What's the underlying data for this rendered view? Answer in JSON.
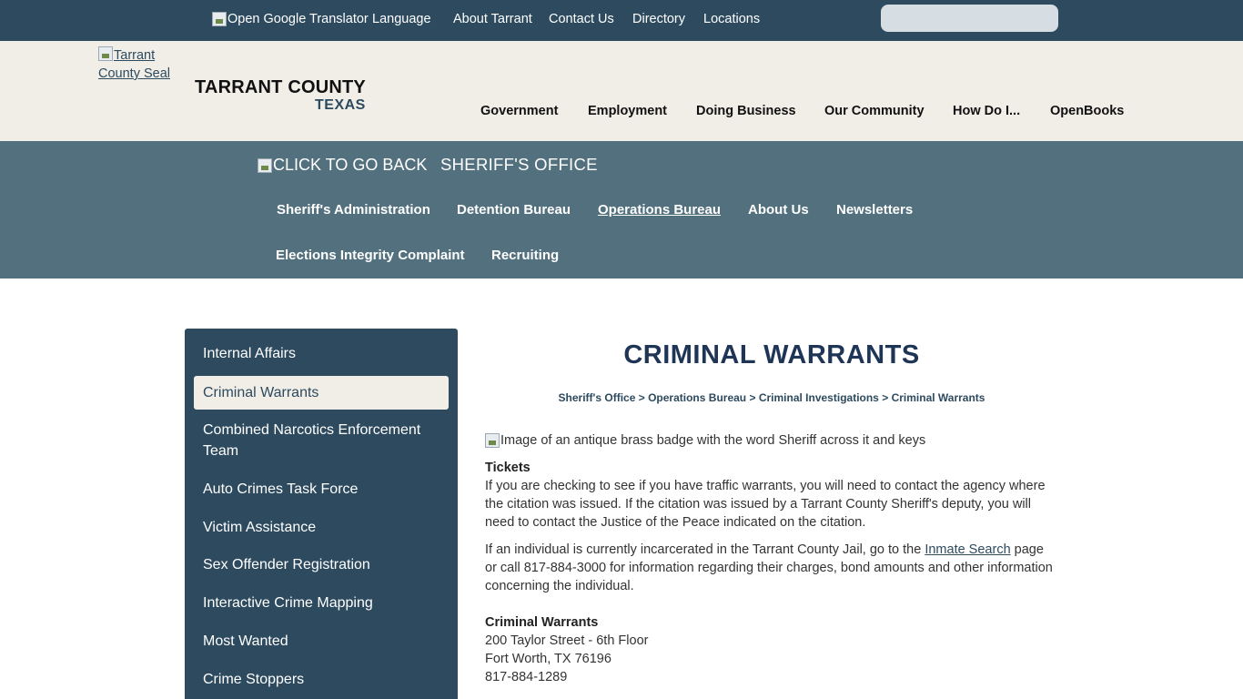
{
  "topbar": {
    "translator_alt": "Open Google Translator",
    "links": [
      "Language",
      "About Tarrant",
      "Contact Us",
      "Directory",
      "Locations"
    ]
  },
  "header": {
    "seal_alt": "Tarrant County Seal",
    "county_name": "TARRANT COUNTY",
    "state": "TEXAS",
    "nav": [
      "Government",
      "Employment",
      "Doing Business",
      "Our Community",
      "How Do I...",
      "OpenBooks"
    ]
  },
  "dept": {
    "back_alt": "CLICK TO GO BACK",
    "title": "SHERIFF'S OFFICE",
    "nav_row1": [
      "Sheriff's Administration",
      "Detention Bureau",
      "Operations Bureau",
      "About Us",
      "Newsletters"
    ],
    "nav_row2": [
      "Elections Integrity Complaint",
      "Recruiting"
    ]
  },
  "sidebar": {
    "items": [
      "Internal Affairs",
      "Criminal Warrants",
      "Combined Narcotics Enforcement Team",
      "Auto Crimes Task Force",
      "Victim Assistance",
      "Sex Offender Registration",
      "Interactive Crime Mapping",
      "Most Wanted",
      "Crime Stoppers"
    ],
    "selected": "Criminal Warrants"
  },
  "main": {
    "title": "CRIMINAL WARRANTS",
    "breadcrumb": {
      "items": [
        "Sheriff's Office",
        "Operations Bureau",
        "Criminal Investigations",
        "Criminal Warrants"
      ],
      "separator": ">"
    },
    "image_alt": "Image of an antique brass badge with the word Sheriff across it and keys",
    "tickets_heading": "Tickets",
    "tickets_text": "If you are checking to see if you have traffic warrants, you will need to contact the agency where the citation was issued. If the citation was issued by a Tarrant County Sheriff's deputy, you will need to contact the Justice of the Peace indicated on the citation.",
    "incarcerated_before": "If an individual is currently incarcerated in the Tarrant County Jail, go to the",
    "inmate_link": "Inmate Search",
    "incarcerated_after": "page or call 817-884-3000 for information regarding their charges, bond amounts and other information concerning the individual.",
    "warrants_heading": "Criminal Warrants",
    "address_line1": "200 Taylor Street - 6th Floor",
    "address_line2": "Fort Worth, TX 76196",
    "phone": "817-884-1289"
  },
  "colors": {
    "topbar": "#2d4a5f",
    "header_bg": "#f1eee8",
    "dept_band": "#52707e",
    "title": "#1e3556"
  }
}
